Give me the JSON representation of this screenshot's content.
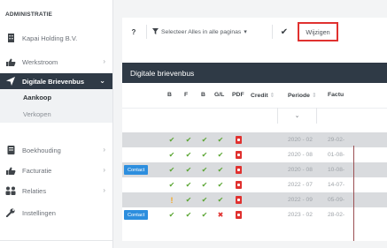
{
  "sidebar": {
    "heading": "ADMINISTRATIE",
    "items": [
      {
        "label": "Kapai Holding B.V.",
        "icon": "building-icon",
        "chevron": ""
      },
      {
        "label": "Werkstroom",
        "icon": "thumbs-up-icon",
        "chevron": "›"
      },
      {
        "label": "Digitale Brievenbus",
        "icon": "send-icon",
        "chevron": "⌄"
      },
      {
        "label": "Boekhouding",
        "icon": "ledger-icon",
        "chevron": "›"
      },
      {
        "label": "Facturatie",
        "icon": "thumbs-up-icon",
        "chevron": "›"
      },
      {
        "label": "Relaties",
        "icon": "users-icon",
        "chevron": "›"
      },
      {
        "label": "Instellingen",
        "icon": "wrench-icon",
        "chevron": ""
      }
    ],
    "subitems": [
      {
        "label": "Aankoop"
      },
      {
        "label": "Verkopen"
      }
    ]
  },
  "toolbar": {
    "help_label": "?",
    "filter_label": "Selecteer Alles in alle paginas",
    "filter_caret": "▾",
    "check_label": "✔",
    "wijzigen_label": "Wijzigen"
  },
  "section": {
    "title": "Digitale brievenbus"
  },
  "table": {
    "columns": [
      "B",
      "F",
      "B",
      "G/L",
      "PDF",
      "Credit",
      "Periode",
      "Factu"
    ],
    "sort_glyph": "⇕",
    "filter_caret": "⌄",
    "rows": [
      {
        "contact": "",
        "b": "ok",
        "f": "ok",
        "b2": "ok",
        "gl": "ok",
        "pdf": true,
        "periode": "2020 - 02",
        "factuur": "29-02-"
      },
      {
        "contact": "",
        "b": "ok",
        "f": "ok",
        "b2": "ok",
        "gl": "ok",
        "pdf": true,
        "periode": "2020 - 08",
        "factuur": "01-08-"
      },
      {
        "contact": "Contact",
        "b": "ok",
        "f": "ok",
        "b2": "ok",
        "gl": "ok",
        "pdf": true,
        "periode": "2020 - 08",
        "factuur": "10-08-"
      },
      {
        "contact": "",
        "b": "ok",
        "f": "ok",
        "b2": "ok",
        "gl": "ok",
        "pdf": true,
        "periode": "2022 - 07",
        "factuur": "14-07-"
      },
      {
        "contact": "",
        "b": "warn",
        "f": "ok",
        "b2": "ok",
        "gl": "ok",
        "pdf": true,
        "periode": "2022 - 09",
        "factuur": "05-09-"
      },
      {
        "contact": "Contact",
        "b": "ok",
        "f": "ok",
        "b2": "ok",
        "gl": "bad",
        "pdf": true,
        "periode": "2023 - 02",
        "factuur": "28-02-"
      }
    ],
    "glyphs": {
      "ok": "✔",
      "warn": "!",
      "bad": "✖"
    }
  },
  "colors": {
    "accent_dark": "#2f3a46",
    "ok_green": "#5aa532",
    "warn_orange": "#f4a31a",
    "error_red": "#e0312f",
    "contact_blue": "#2d8ede"
  }
}
